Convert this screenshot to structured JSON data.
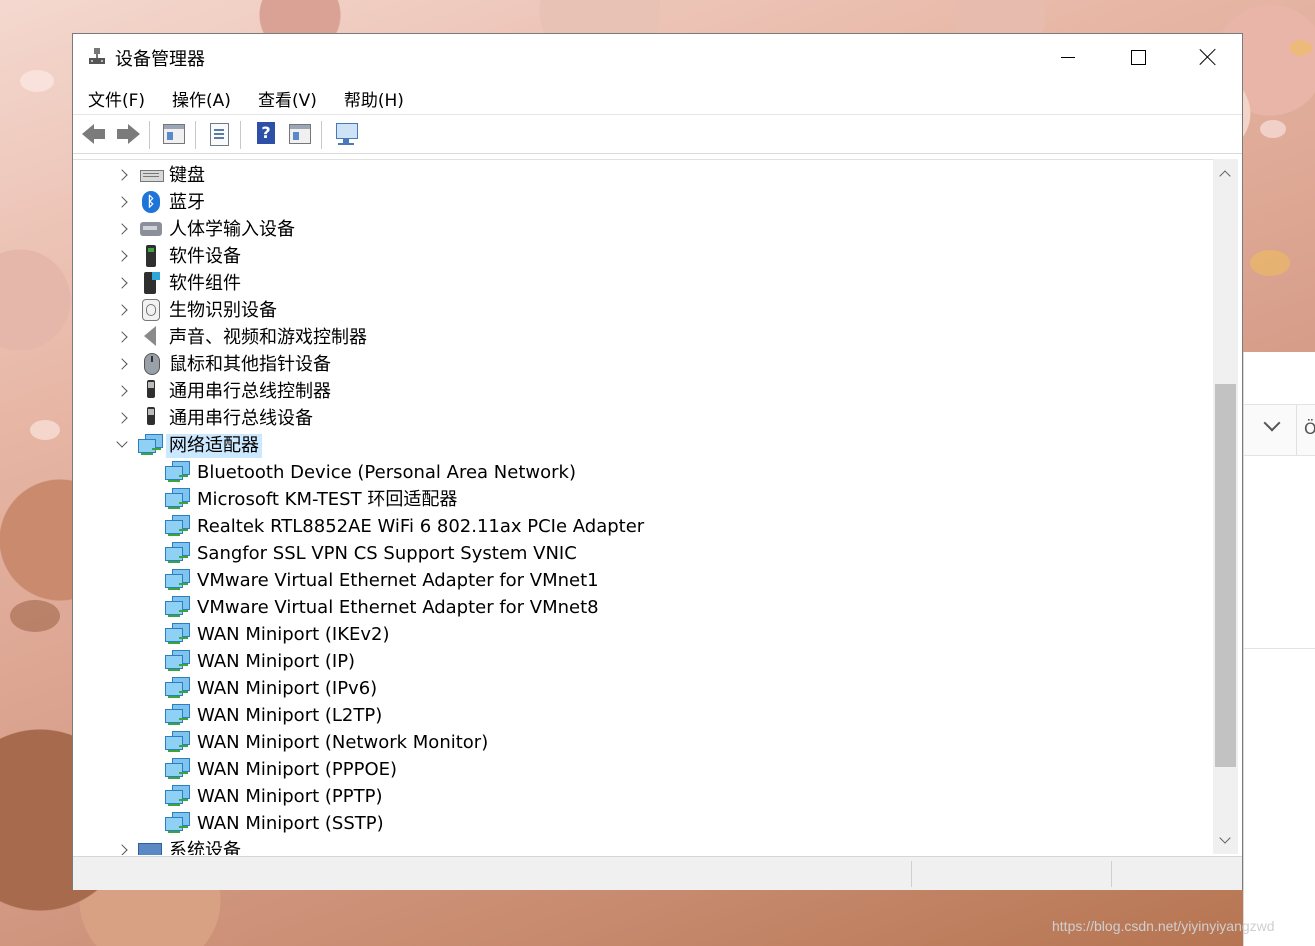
{
  "window": {
    "title": "设备管理器",
    "controls": {
      "minimize": "minimize",
      "maximize": "maximize",
      "close": "close"
    }
  },
  "menu": [
    "文件(F)",
    "操作(A)",
    "查看(V)",
    "帮助(H)"
  ],
  "toolbar": [
    {
      "name": "back-button",
      "icon": "arrow-left-icon"
    },
    {
      "name": "forward-button",
      "icon": "arrow-right-icon"
    },
    {
      "name": "show-hide-console-tree-button",
      "icon": "console-tree-icon"
    },
    {
      "name": "properties-button",
      "icon": "properties-icon"
    },
    {
      "name": "help-button",
      "icon": "help-icon",
      "glyph": "?"
    },
    {
      "name": "action-pane-button",
      "icon": "action-pane-icon"
    },
    {
      "name": "scan-hardware-button",
      "icon": "monitor-scan-icon"
    }
  ],
  "tree": {
    "categories": [
      {
        "label": "键盘",
        "icon": "keyboard-icon",
        "expanded": false
      },
      {
        "label": "蓝牙",
        "icon": "bluetooth-icon",
        "expanded": false
      },
      {
        "label": "人体学输入设备",
        "icon": "hid-icon",
        "expanded": false
      },
      {
        "label": "软件设备",
        "icon": "software-device-icon",
        "expanded": false
      },
      {
        "label": "软件组件",
        "icon": "software-component-icon",
        "expanded": false
      },
      {
        "label": "生物识别设备",
        "icon": "fingerprint-icon",
        "expanded": false
      },
      {
        "label": "声音、视频和游戏控制器",
        "icon": "speaker-icon",
        "expanded": false
      },
      {
        "label": "鼠标和其他指针设备",
        "icon": "mouse-icon",
        "expanded": false
      },
      {
        "label": "通用串行总线控制器",
        "icon": "usb-icon",
        "expanded": false
      },
      {
        "label": "通用串行总线设备",
        "icon": "usb-icon",
        "expanded": false
      },
      {
        "label": "网络适配器",
        "icon": "network-adapter-icon",
        "expanded": true,
        "selected": true
      }
    ],
    "network_adapters": [
      "Bluetooth Device (Personal Area Network)",
      "Microsoft KM-TEST 环回适配器",
      "Realtek RTL8852AE WiFi 6 802.11ax PCIe Adapter",
      "Sangfor SSL VPN CS Support System VNIC",
      "VMware Virtual Ethernet Adapter for VMnet1",
      "VMware Virtual Ethernet Adapter for VMnet8",
      "WAN Miniport (IKEv2)",
      "WAN Miniport (IP)",
      "WAN Miniport (IPv6)",
      "WAN Miniport (L2TP)",
      "WAN Miniport (Network Monitor)",
      "WAN Miniport (PPPOE)",
      "WAN Miniport (PPTP)",
      "WAN Miniport (SSTP)"
    ],
    "after": [
      {
        "label": "系统设备",
        "icon": "system-devices-icon",
        "expanded": false
      }
    ]
  },
  "status_bar": {
    "segments": [
      "",
      "",
      ""
    ]
  },
  "background_window": {
    "partial_glyph": "Ö"
  },
  "watermark": "https://blog.csdn.net/yiyinyiyangzwd",
  "colors": {
    "selection": "#cce8ff",
    "accent": "#2b7fc1"
  }
}
